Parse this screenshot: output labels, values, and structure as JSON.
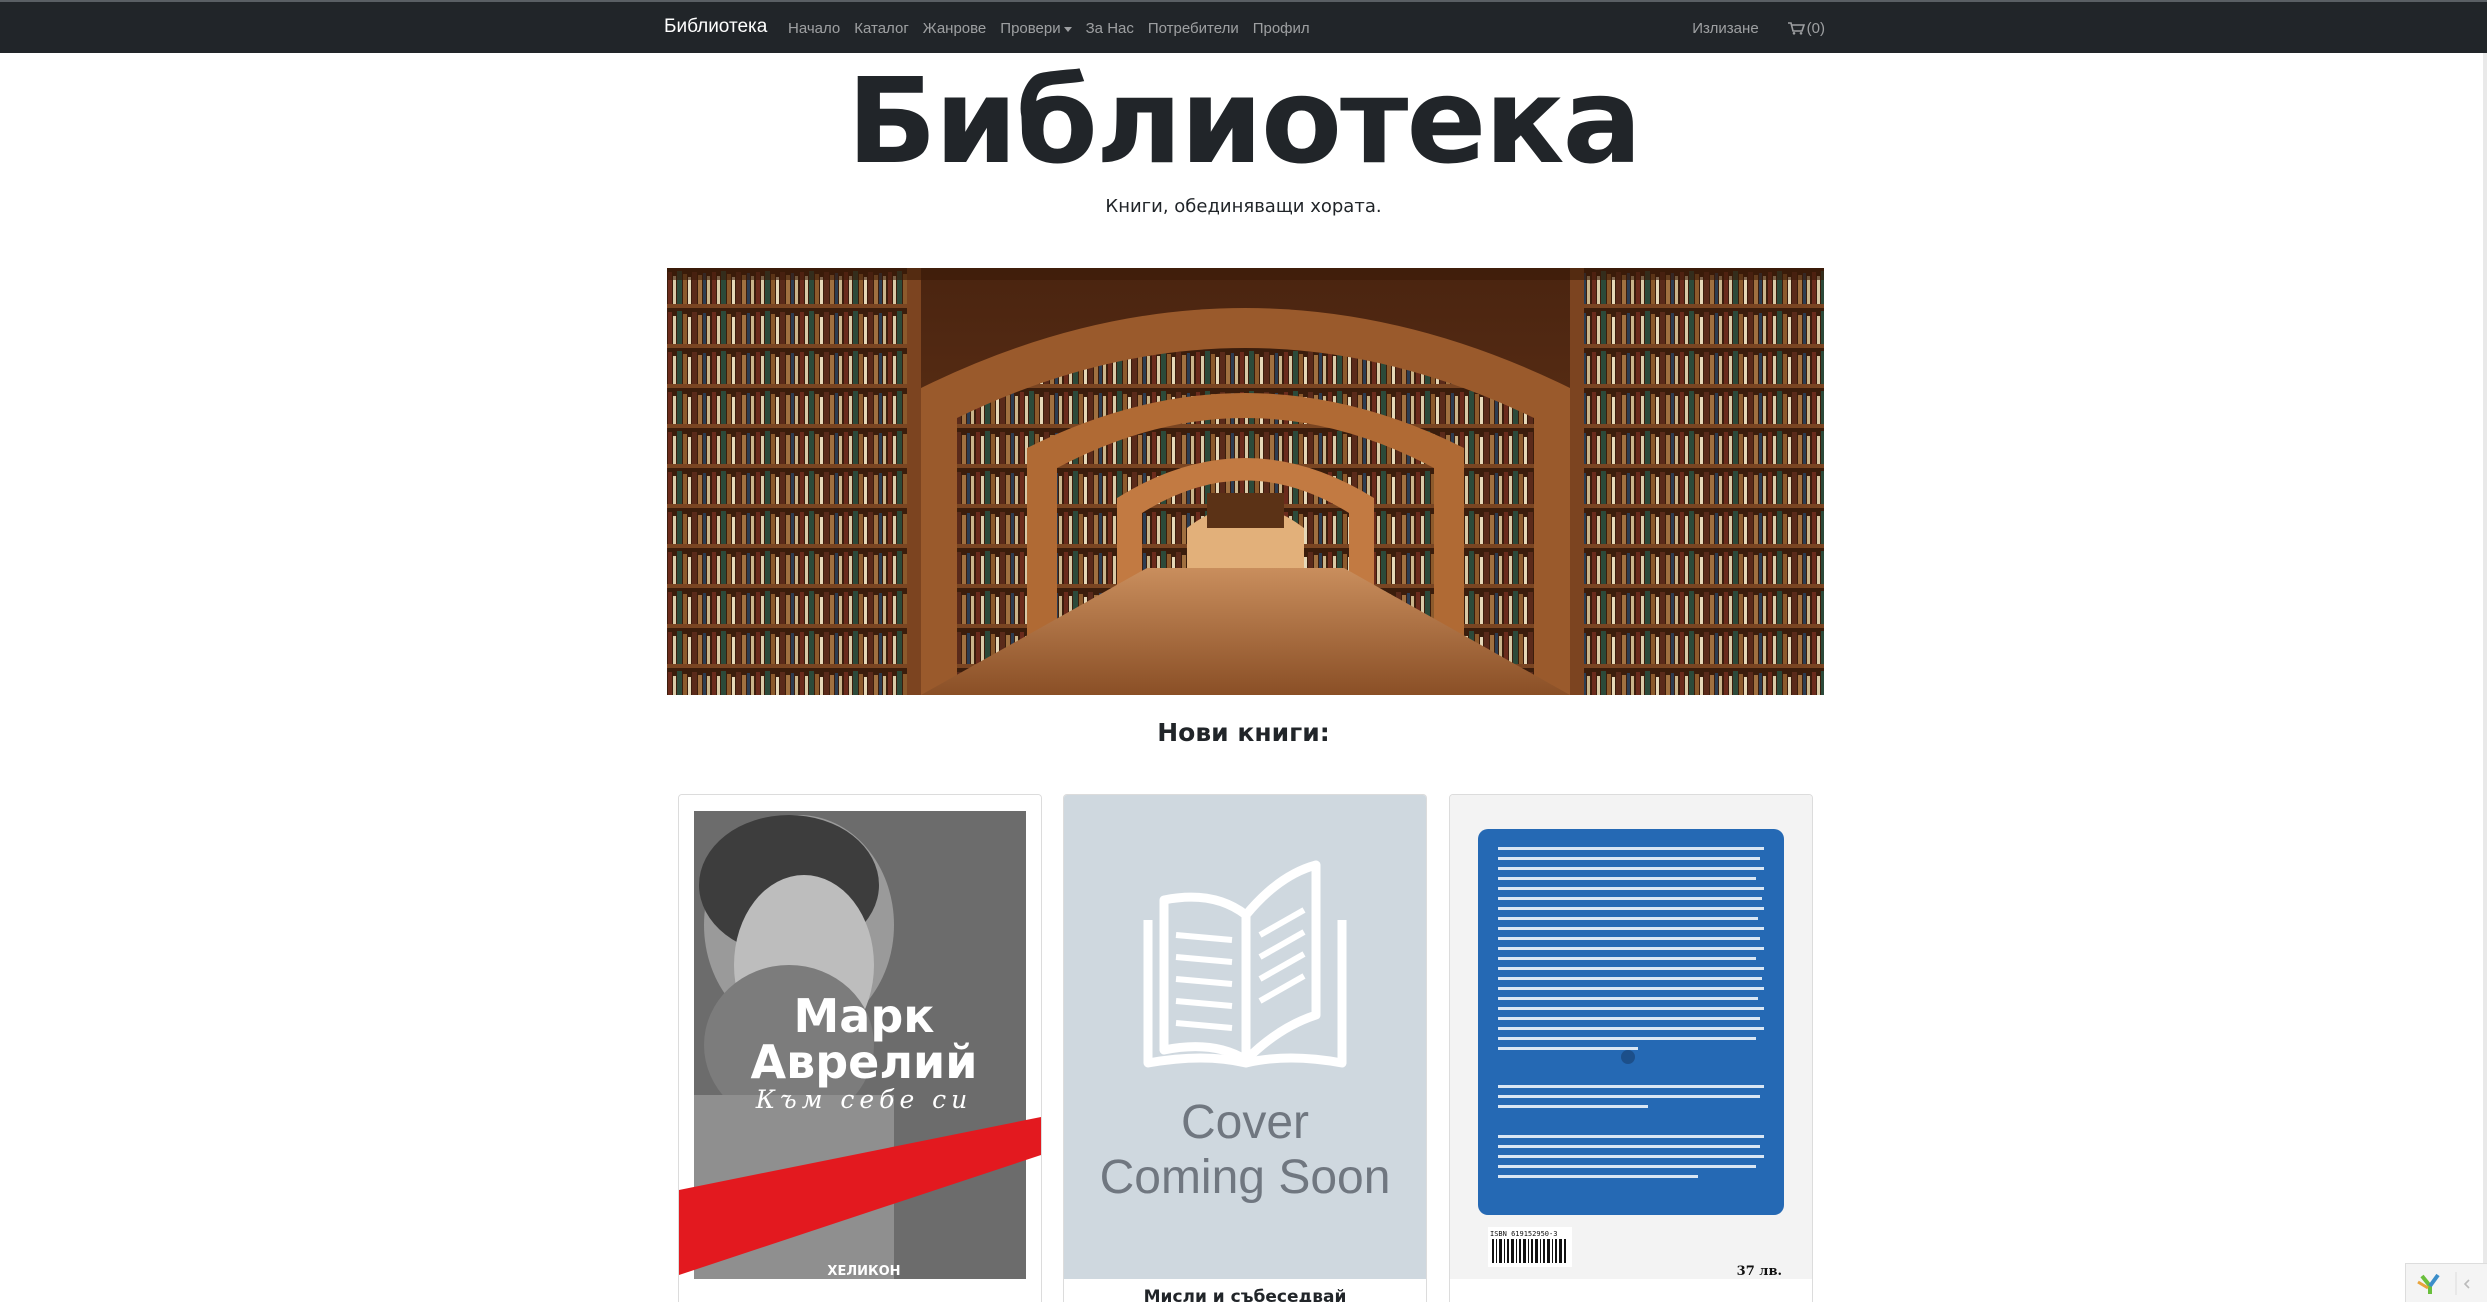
{
  "navbar": {
    "brand": "Библиотека",
    "items": [
      {
        "label": "Начало"
      },
      {
        "label": "Каталог"
      },
      {
        "label": "Жанрове"
      },
      {
        "label": "Провери"
      },
      {
        "label": "За Нас"
      },
      {
        "label": "Потребители"
      },
      {
        "label": "Профил"
      }
    ],
    "logout": "Излизане",
    "cart_count": "(0)"
  },
  "hero": {
    "title": "Библиотека",
    "subtitle": "Книги, обединяващи хората."
  },
  "new_books": {
    "heading": "Нови книги:",
    "books": [
      {
        "caption": "",
        "cover_author": "Марк Аврелий",
        "cover_author_line1": "Марк",
        "cover_author_line2": "Аврелий",
        "cover_title": "Към себе си",
        "cover_publisher": "ХЕЛИКОН"
      },
      {
        "caption": "Мисли и събеседвай",
        "placeholder_line1": "Cover",
        "placeholder_line2": "Coming Soon"
      },
      {
        "caption": "",
        "isbn": "ISBN 619152950-3",
        "price": "37 лв."
      }
    ]
  },
  "colors": {
    "navbar_bg": "#212529",
    "cover_placeholder_bg": "#cfd8df",
    "cover_blue": "#2569b4",
    "cover_red": "#e3191f"
  }
}
